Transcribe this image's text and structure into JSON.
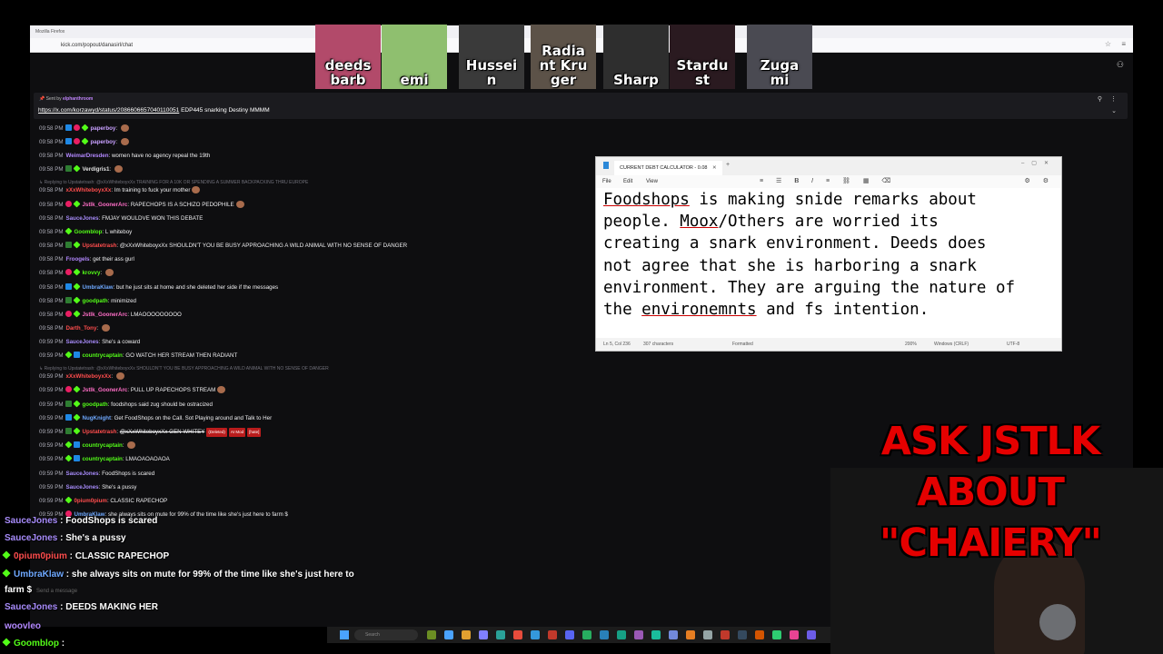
{
  "browser": {
    "title": "Mozilla Firefox",
    "url": "kick.com/popout/danasirl/chat"
  },
  "pinned": {
    "sent_by_label": "Sent by",
    "sent_by_user": "elphanthroom",
    "link": "https://x.com/korzawyd/status/2086606657040110051",
    "text": "EDP445 snarking Destiny MMMM"
  },
  "chat": [
    {
      "ts": "09:58 PM",
      "badges": [
        "sub",
        "vip",
        "gift"
      ],
      "user": "paperboy",
      "color": "#c8a0ff",
      "text": "",
      "emote": true
    },
    {
      "ts": "09:58 PM",
      "badges": [
        "sub",
        "vip",
        "gift"
      ],
      "user": "paperboy",
      "color": "#c8a0ff",
      "text": "",
      "emote": true
    },
    {
      "ts": "09:58 PM",
      "badges": [],
      "user": "WeimarDresden",
      "color": "#b388ff",
      "text": "women have no agency repeal the 19th"
    },
    {
      "ts": "09:58 PM",
      "badges": [
        "mod",
        "gift"
      ],
      "user": "Verdigris1",
      "color": "#e0e0e0",
      "text": "",
      "emote": true
    },
    {
      "ts": "09:58 PM",
      "badges": [],
      "user": "xXxWhiteboyxXx",
      "color": "#ff4d4d",
      "text": "Im training to fuck your mother",
      "emote": true
    },
    {
      "ts": "09:58 PM",
      "badges": [
        "vip",
        "gift"
      ],
      "user": "Jstlk_GoonerArc",
      "color": "#ff6ec7",
      "text": "RAPECHOPS IS A SCHIZO PEDOPHILE",
      "emote": true
    },
    {
      "ts": "09:58 PM",
      "badges": [],
      "user": "SauceJones",
      "color": "#a78bfa",
      "text": "FMJAY WOULDVE WON THIS DEBATE"
    },
    {
      "ts": "09:58 PM",
      "badges": [
        "gift"
      ],
      "user": "Goomblop",
      "color": "#53fc18",
      "text": "L whiteboy"
    },
    {
      "ts": "09:58 PM",
      "badges": [
        "mod",
        "gift"
      ],
      "user": "Upstatetrash",
      "color": "#ff4d4d",
      "text": "@xXxWhiteboyxXx SHOULDN'T YOU BE BUSY APPROACHING A WILD ANIMAL WITH NO SENSE OF DANGER"
    },
    {
      "ts": "09:58 PM",
      "badges": [],
      "user": "Froogels",
      "color": "#b388ff",
      "text": "get their ass gurl"
    },
    {
      "ts": "09:58 PM",
      "badges": [
        "vip",
        "gift"
      ],
      "user": "krovvy",
      "color": "#53fc18",
      "text": "",
      "emote": true
    },
    {
      "ts": "09:58 PM",
      "badges": [
        "sub",
        "gift"
      ],
      "user": "UmbraKlaw",
      "color": "#6ea8fe",
      "text": "but he just sits at home and she deleted her side if the messages"
    },
    {
      "ts": "09:58 PM",
      "badges": [
        "mod",
        "gift"
      ],
      "user": "goodpath",
      "color": "#53fc18",
      "text": "minimized"
    },
    {
      "ts": "09:58 PM",
      "badges": [
        "vip",
        "gift"
      ],
      "user": "Jstlk_GoonerArc",
      "color": "#ff6ec7",
      "text": "LMAOOOOOOOOO"
    },
    {
      "ts": "09:58 PM",
      "badges": [],
      "user": "Darth_Tony",
      "color": "#ff4d4d",
      "text": "",
      "emote": true
    },
    {
      "ts": "09:59 PM",
      "badges": [],
      "user": "SauceJones",
      "color": "#a78bfa",
      "text": "She's a coward"
    },
    {
      "ts": "09:59 PM",
      "badges": [
        "gift",
        "sub"
      ],
      "user": "countrycaptain",
      "color": "#53fc18",
      "text": "GO WATCH HER STREAM THEN RADIANT"
    },
    {
      "ts": "09:59 PM",
      "badges": [],
      "user": "xXxWhiteboyxXx",
      "color": "#ff4d4d",
      "text": "",
      "emote": true
    },
    {
      "ts": "09:59 PM",
      "badges": [
        "vip",
        "gift"
      ],
      "user": "Jstlk_GoonerArc",
      "color": "#ff6ec7",
      "text": "PULL UP RAPECHOPS STREAM",
      "emote": true
    },
    {
      "ts": "09:59 PM",
      "badges": [
        "mod",
        "gift"
      ],
      "user": "goodpath",
      "color": "#53fc18",
      "text": "foodshops said zug should be ostracized"
    },
    {
      "ts": "09:59 PM",
      "badges": [
        "sub",
        "gift"
      ],
      "user": "NugKnight",
      "color": "#6ea8fe",
      "text": "Get FoodShops on the Call. Sot Playing around and Talk to Her"
    },
    {
      "ts": "09:59 PM",
      "badges": [
        "mod",
        "gift"
      ],
      "user": "Upstatetrash",
      "color": "#ff4d4d",
      "text": "@xXxWhiteboyxXx GEN WHITEY",
      "deleted": true,
      "tags": [
        "(Deleted)",
        "AI Mod",
        "[hate]"
      ]
    },
    {
      "ts": "09:59 PM",
      "badges": [
        "gift",
        "sub"
      ],
      "user": "countrycaptain",
      "color": "#53fc18",
      "text": "",
      "emote": true
    },
    {
      "ts": "09:59 PM",
      "badges": [
        "gift",
        "sub"
      ],
      "user": "countrycaptain",
      "color": "#53fc18",
      "text": "LMAOAOAOAOA"
    },
    {
      "ts": "09:59 PM",
      "badges": [],
      "user": "SauceJones",
      "color": "#a78bfa",
      "text": "FoodShops is scared"
    },
    {
      "ts": "09:59 PM",
      "badges": [],
      "user": "SauceJones",
      "color": "#a78bfa",
      "text": "She's a pussy"
    },
    {
      "ts": "09:59 PM",
      "badges": [
        "gift"
      ],
      "user": "0pium0pium",
      "color": "#ff4d4d",
      "text": "CLASSIC RAPECHOP"
    },
    {
      "ts": "09:59 PM",
      "badges": [
        "vip"
      ],
      "user": "UmbraKlaw",
      "color": "#6ea8fe",
      "text": "she always sits on mute for 99% of the time like she's just here to farm $"
    }
  ],
  "replies": [
    "Replying to Upstatetrash: @xXxWhiteboyxXx TRAINING FOR A 10K OR SPENDING A SUMMER BACKPACKING THRU EUROPE",
    "Replying to Upstatetrash: @xXxWhiteboyxXx SHOULDN'T YOU BE BUSY APPROACHING A WILD ANIMAL WITH NO SENSE OF DANGER"
  ],
  "notepad": {
    "tab_title": "CURRENT DEBT CALCULATOR - 0.08",
    "menus": [
      "File",
      "Edit",
      "View"
    ],
    "body_lines": [
      [
        {
          "t": "Foodshops",
          "u": true
        },
        {
          "t": " is making snide remarks about"
        }
      ],
      [
        {
          "t": "people. "
        },
        {
          "t": "Moox",
          "u": true
        },
        {
          "t": "/Others are worried its"
        }
      ],
      [
        {
          "t": "creating a snark environment. Deeds does"
        }
      ],
      [
        {
          "t": "not agree that she is harboring a snark"
        }
      ],
      [
        {
          "t": "environment. They are arguing the nature of"
        }
      ],
      [
        {
          "t": "the "
        },
        {
          "t": "environemnts",
          "u": true
        },
        {
          "t": " and fs intention."
        }
      ]
    ],
    "status": {
      "position": "Ln 5, Col 236",
      "chars": "307 characters",
      "format": "Formatted",
      "zoom": "200%",
      "eol": "Windows (CRLF)",
      "encoding": "UTF-8"
    }
  },
  "cams": [
    {
      "name_l1": "deeds",
      "name_l2": "barb",
      "bg": "#b24a6a"
    },
    {
      "name_l1": "emi",
      "name_l2": "",
      "bg": "#8fbf6f"
    },
    {
      "name_l1": "Hussei",
      "name_l2": "n",
      "bg": "#3a3a3a"
    },
    {
      "name_l1": "Radia",
      "name_l2": "nt Kru",
      "name_l3": "ger",
      "bg": "#5c5248"
    },
    {
      "name_l1": "Sharp",
      "name_l2": "",
      "bg": "#2e2e2e"
    },
    {
      "name_l1": "Stardu",
      "name_l2": "st",
      "bg": "#2a1a20"
    },
    {
      "name_l1": "Zuga",
      "name_l2": "mi",
      "bg": "#4a4a52"
    }
  ],
  "banner": [
    "ASK JSTLK",
    "ABOUT",
    "\"CHAIERY\""
  ],
  "overlay_chat": [
    {
      "user": "SauceJones",
      "color": "#a78bfa",
      "text": ": FoodShops is scared",
      "badge": false
    },
    {
      "user": "SauceJones",
      "color": "#a78bfa",
      "text": ": She's a pussy",
      "badge": false
    },
    {
      "user": "0pium0pium",
      "color": "#ff4d4d",
      "text": ": CLASSIC RAPECHOP",
      "badge": true
    },
    {
      "user": "UmbraKlaw",
      "color": "#6ea8fe",
      "text": ": she always sits on mute for 99% of the time like she's just here to",
      "badge": true
    },
    {
      "user": "",
      "color": "#fff",
      "text": "farm $",
      "badge": false
    },
    {
      "user": "SauceJones",
      "color": "#a78bfa",
      "text": ": DEEDS MAKING HER",
      "badge": false
    },
    {
      "user": "woovleo",
      "color": "#b388ff",
      "text": "",
      "badge": false
    },
    {
      "user": "Goomblop",
      "color": "#53fc18",
      "text": ":",
      "badge": true
    }
  ],
  "chat_input_placeholder": "Send a message",
  "taskbar": {
    "search_placeholder": "Search"
  }
}
